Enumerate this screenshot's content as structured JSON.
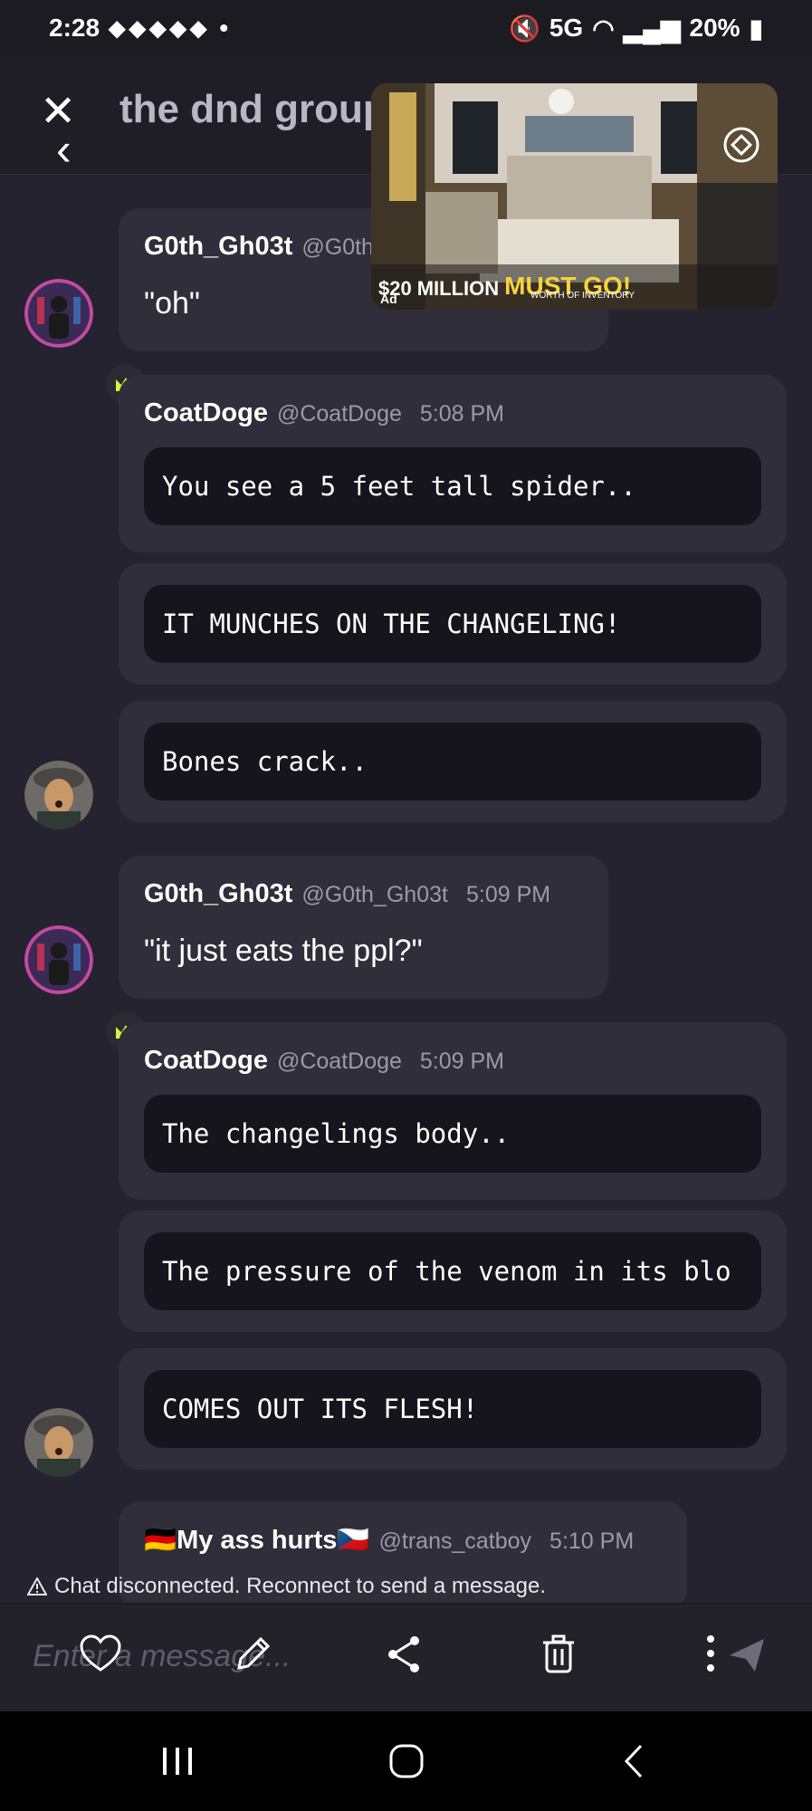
{
  "status": {
    "time": "2:28",
    "dot": "•",
    "network": "5G",
    "battery": "20%"
  },
  "header": {
    "title": "the dnd group"
  },
  "ad": {
    "amount": "$20",
    "label": "MILLION",
    "headline": "MUST GO!",
    "sub": "WORTH OF INVENTORY",
    "tag": "Ad"
  },
  "messages": [
    {
      "author": "G0th_Gh03t",
      "handle": "@G0th_Gh03t",
      "text": "\"oh\""
    },
    {
      "author": "CoatDoge",
      "handle": "@CoatDoge",
      "time": "5:08 PM",
      "code": "You see a 5 feet tall spider.."
    },
    {
      "code": "IT MUNCHES ON THE CHANGELING!"
    },
    {
      "code": "Bones crack.."
    },
    {
      "author": "G0th_Gh03t",
      "handle": "@G0th_Gh03t",
      "time": "5:09 PM",
      "text": "\"it just eats the ppl?\""
    },
    {
      "author": "CoatDoge",
      "handle": "@CoatDoge",
      "time": "5:09 PM",
      "code": "The changelings body.."
    },
    {
      "code": "The pressure of the venom in its blo"
    },
    {
      "code": "COMES OUT ITS FLESH!"
    },
    {
      "author": "🇩🇪My ass hurts🇨🇿",
      "handle": "@trans_catboy",
      "time": "5:10 PM"
    }
  ],
  "notice": "Chat disconnected. Reconnect to send a message.",
  "composer": {
    "placeholder": "Enter a message..."
  },
  "icons": [
    "close-icon",
    "back-icon",
    "rotate-icon",
    "crown-icon",
    "heart-icon",
    "pencil-icon",
    "share-icon",
    "trash-icon",
    "more-icon",
    "send-icon"
  ],
  "colors": {
    "crown": "#d9f23a",
    "background": "#25232f",
    "card": "#2f2e3a"
  }
}
